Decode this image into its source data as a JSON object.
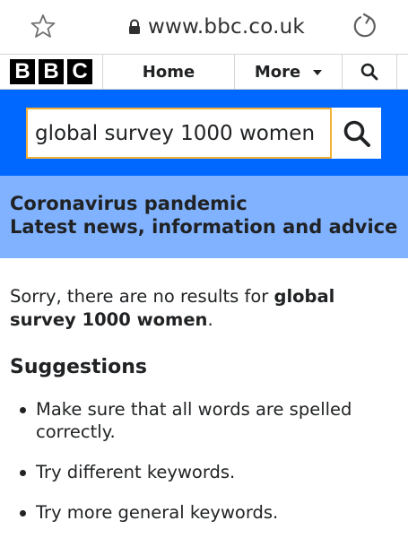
{
  "browser": {
    "url": "www.bbc.co.uk",
    "icons": {
      "bookmark": "star-icon",
      "secure": "lock-icon",
      "reload": "reload-icon"
    }
  },
  "nav": {
    "logo_letters": [
      "B",
      "B",
      "C"
    ],
    "home_label": "Home",
    "more_label": "More",
    "icons": {
      "more": "chevron-down-icon",
      "search": "search-icon"
    }
  },
  "search": {
    "query": "global survey 1000 women",
    "button_icon": "search-icon"
  },
  "banner": {
    "title": "Coronavirus pandemic",
    "subtitle": "Latest news, information and advice"
  },
  "results": {
    "sorry_prefix": "Sorry, there are no results for ",
    "sorry_query": "global survey 1000 women",
    "sorry_suffix": ".",
    "suggestions_title": "Suggestions",
    "suggestions": [
      "Make sure that all words are spelled correctly.",
      "Try different keywords.",
      "Try more general keywords."
    ]
  },
  "colors": {
    "search_band": "#0068ff",
    "banner": "#80b2ff",
    "input_focus_border": "#f2b134",
    "text": "#202224"
  }
}
